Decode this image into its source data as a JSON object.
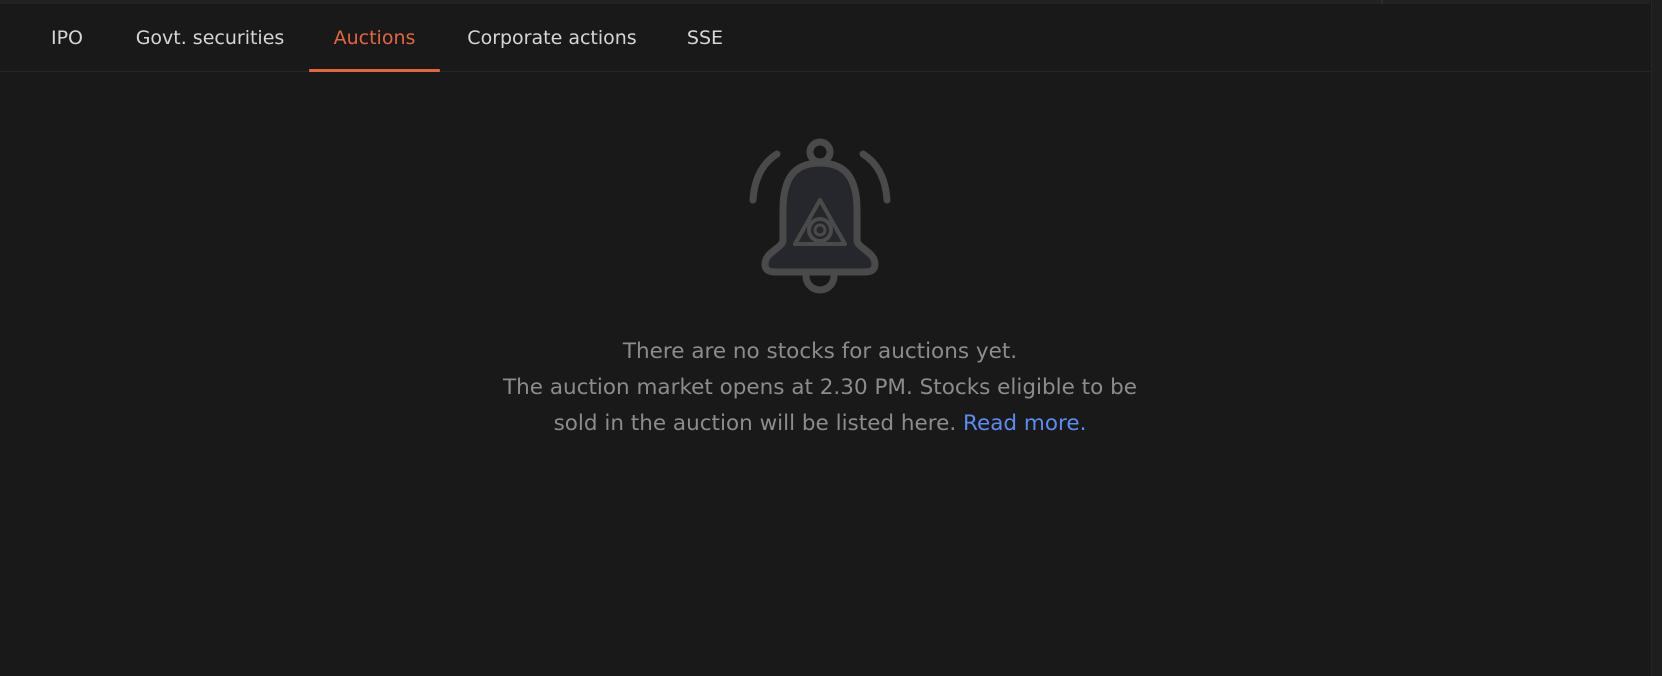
{
  "tabs": [
    {
      "label": "IPO",
      "active": false
    },
    {
      "label": "Govt. securities",
      "active": false
    },
    {
      "label": "Auctions",
      "active": true
    },
    {
      "label": "Corporate actions",
      "active": false
    },
    {
      "label": "SSE",
      "active": false
    }
  ],
  "empty_state": {
    "icon": "bell-icon",
    "title": "There are no stocks for auctions yet.",
    "line2": "The auction market opens at 2.30 PM. Stocks eligible to be",
    "line3": "sold in the auction will be listed here.",
    "link_label": "Read more."
  },
  "colors": {
    "background": "#191919",
    "active_tab": "#e2673d",
    "link": "#5b8cf0",
    "muted_text": "#8c8c8c"
  }
}
